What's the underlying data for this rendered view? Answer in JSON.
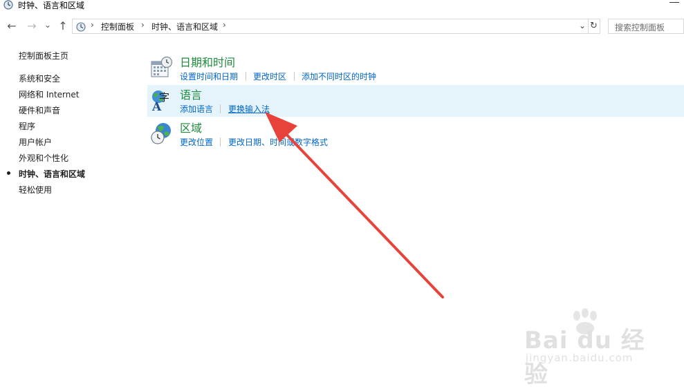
{
  "window": {
    "title": "时钟、语言和区域"
  },
  "nav": {
    "back": "←",
    "forward": "→",
    "recent": "⌄",
    "up": "↑"
  },
  "address": {
    "crumbs": [
      "控制面板",
      "时钟、语言和区域"
    ],
    "separator": "›",
    "dropdown": "⌄",
    "refresh": "↻"
  },
  "search": {
    "placeholder": "搜索控制面板"
  },
  "sidebar": {
    "home": "控制面板主页",
    "items": [
      {
        "label": "系统和安全"
      },
      {
        "label": "网络和 Internet"
      },
      {
        "label": "硬件和声音"
      },
      {
        "label": "程序"
      },
      {
        "label": "用户帐户"
      },
      {
        "label": "外观和个性化"
      },
      {
        "label": "时钟、语言和区域",
        "current": true
      },
      {
        "label": "轻松使用"
      }
    ]
  },
  "categories": [
    {
      "title": "日期和时间",
      "icon": "calendar-clock-icon",
      "links": [
        "设置时间和日期",
        "更改时区",
        "添加不同时区的时钟"
      ]
    },
    {
      "title": "语言",
      "icon": "language-icon",
      "links": [
        "添加语言",
        "更换输入法"
      ]
    },
    {
      "title": "区域",
      "icon": "globe-clock-icon",
      "links": [
        "更改位置",
        "更改日期、时间或数字格式"
      ]
    }
  ],
  "watermark": {
    "brand": "Bai du 经验",
    "url": "jingyan.baidu.com"
  },
  "colors": {
    "link": "#0066cc",
    "category_title": "#1e8a3c",
    "hover_bg": "#e5f3fb",
    "arrow": "#e8433a"
  }
}
